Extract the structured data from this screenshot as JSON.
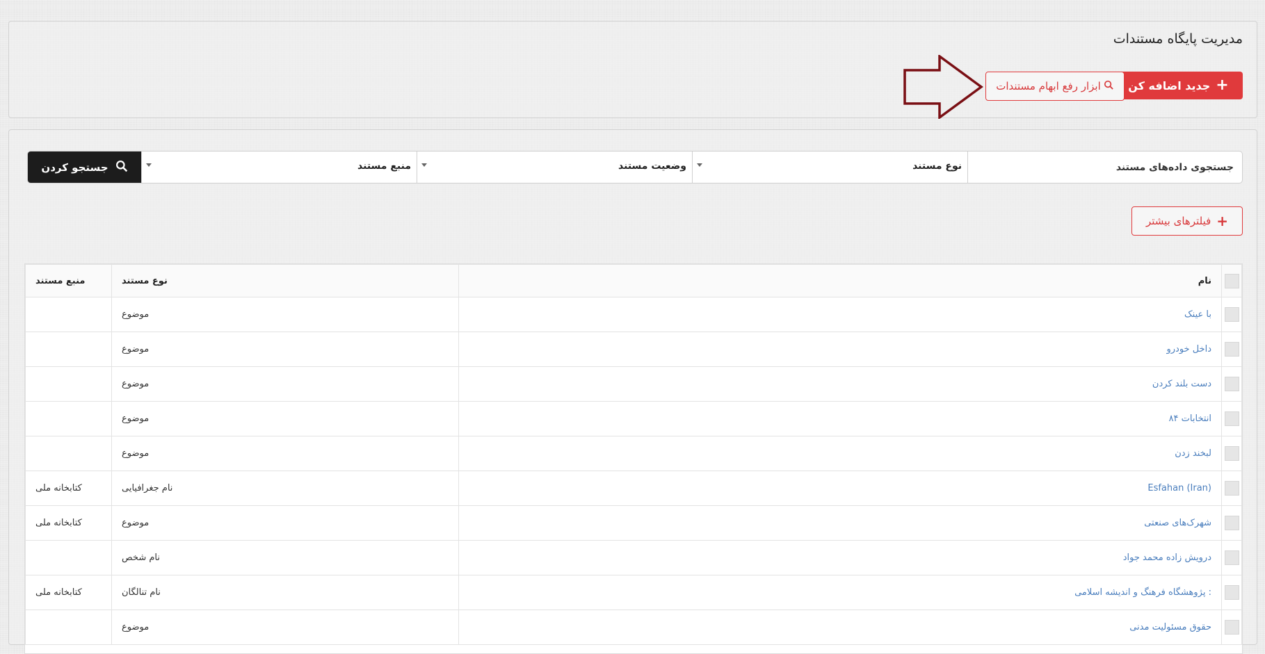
{
  "header": {
    "title": "مدیریت پایگاه مستندات",
    "add_button_label": "جدید اضافه کن",
    "disambiguation_button_label": "ابزار رفع ابهام مستندات"
  },
  "filters": {
    "search_label": "جستجوی داده‌های مستند",
    "doc_type_label": "نوع مستند",
    "status_label": "وضعیت مستند",
    "source_label": "منبع مستند",
    "search_button_label": "جستجو کردن",
    "more_filters_label": "فیلترهای بیشتر"
  },
  "table": {
    "columns": [
      "نام",
      "نوع مستند",
      "منبع مستند"
    ],
    "rows": [
      {
        "name": "با عینک",
        "type": "موضوع",
        "source": ""
      },
      {
        "name": "داخل خودرو",
        "type": "موضوع",
        "source": ""
      },
      {
        "name": "دست بلند کردن",
        "type": "موضوع",
        "source": ""
      },
      {
        "name": "انتخابات ۸۴",
        "type": "موضوع",
        "source": ""
      },
      {
        "name": "لبخند زدن",
        "type": "موضوع",
        "source": ""
      },
      {
        "name": "Esfahan (Iran)",
        "type": "نام جغرافیایی",
        "source": "کتابخانه ملی"
      },
      {
        "name": "شهرک‌های صنعتی",
        "type": "موضوع",
        "source": "کتابخانه ملی"
      },
      {
        "name": "درویش زاده محمد جواد",
        "type": "نام شخص",
        "source": ""
      },
      {
        "name": ": پژوهشگاه فرهنگ و اندیشه اسلامی",
        "type": "نام تنالگان",
        "source": "کتابخانه ملی"
      },
      {
        "name": "حقوق مسئولیت مدنی",
        "type": "موضوع",
        "source": ""
      }
    ]
  },
  "colors": {
    "accent": "#e03a3c",
    "annotation_arrow": "#7a0f14",
    "link": "#4a7ebd",
    "search_button": "#1c1c1c"
  }
}
